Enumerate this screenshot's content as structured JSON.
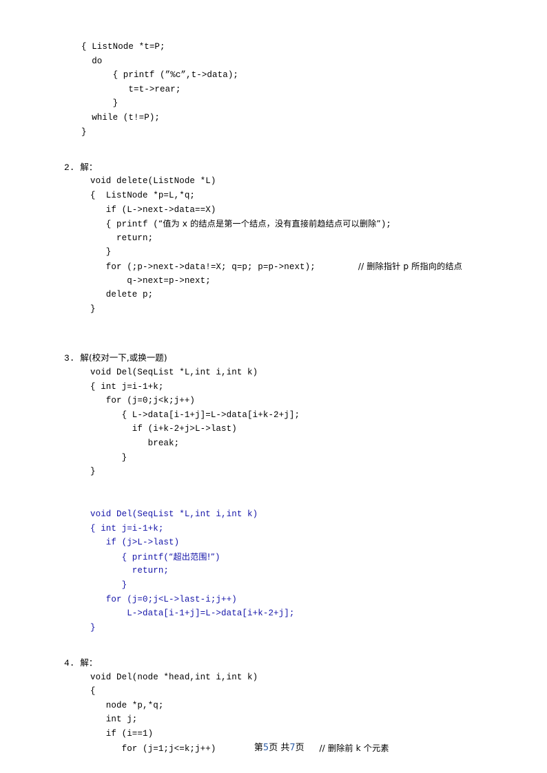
{
  "document": {
    "type": "exam-answer-sheet",
    "language": "zh-CN",
    "colors": {
      "text": "#000000",
      "code_blue": "#1414a8",
      "page_number": "#2f5fa8",
      "background": "#ffffff"
    }
  },
  "block1": {
    "lines": [
      "{ ListNode *t=P;",
      "  do",
      "      { printf (”%c”,t->data);",
      "         t=t->rear;",
      "      }",
      "  while (t!=P);",
      "}"
    ]
  },
  "section2": {
    "number": "2.",
    "label": "解：",
    "lines": [
      "void delete(ListNode *L)",
      "{  ListNode *p=L,*q;",
      "   if (L->next->data==X)",
      "   { printf (",
      "     return;",
      "   }",
      "   for (;p->next->data!=X; q=p; p=p->next);",
      "       q->next=p->next;",
      "   delete p;",
      "}"
    ],
    "printf_chinese": "“值为 x 的结点是第一个结点，没有直接前趋结点可以删除”",
    "printf_prefix": "   { printf (",
    "printf_suffix": ");",
    "for_line": "   for (;p->next->data!=X; q=p; p=p->next);",
    "for_comment": "// 删除指针 p 所指向的结点"
  },
  "section3": {
    "number": "3.",
    "label": "解(校对一下,或换一题)",
    "lines_black": [
      "void Del(SeqList *L,int i,int k)",
      "{ int j=i-1+k;",
      "   for (j=0;j<k;j++)",
      "      { L->data[i-1+j]=L->data[i+k-2+j];",
      "        if (i+k-2+j>L->last)",
      "           break;",
      "      }",
      "}"
    ],
    "lines_blue": [
      "void Del(SeqList *L,int i,int k)",
      "{ int j=i-1+k;",
      "   if (j>L->last)",
      "      { printf(",
      "        return;",
      "      }",
      "   for (j=0;j<L->last-i;j++)",
      "       L->data[i-1+j]=L->data[i+k-2+j];",
      "}"
    ],
    "blue_printf_prefix": "      { printf(",
    "blue_printf_chinese": "“超出范围!”",
    "blue_printf_suffix": ")"
  },
  "section4": {
    "number": "4.",
    "label": "解：",
    "lines": [
      "void Del(node *head,int i,int k)",
      "{",
      "   node *p,*q;",
      "   int j;",
      "   if (i==1)",
      "      for (j=1;j<=k;j++)"
    ],
    "for_line": "      for (j=1;j<=k;j++)",
    "for_comment": "// 删除前 k 个元素"
  },
  "footer": {
    "prefix": "第",
    "current_page": "5",
    "middle": "页 共",
    "total_pages": "7",
    "suffix": "页"
  }
}
